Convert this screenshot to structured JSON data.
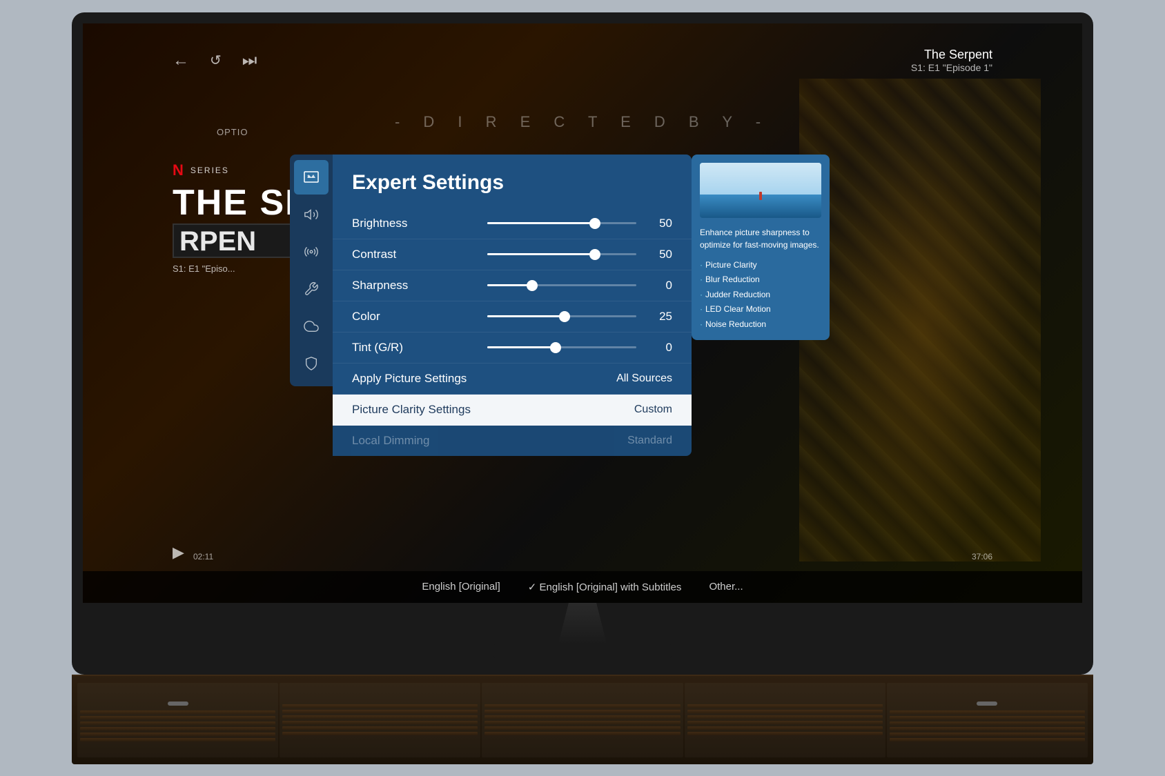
{
  "tv": {
    "show_title": "The Serpent",
    "show_episode": "S1: E1 \"Episode 1\"",
    "directed_by": "- D I R E C T E D   B Y -",
    "netflix_badge": "N",
    "netflix_series": "SERIES",
    "show_name": "THE SE",
    "show_info": "S1: E1 \"Episo",
    "options_label": "OPTIO",
    "time_left": "02:11",
    "time_right": "37:06"
  },
  "subtitles": {
    "option1": "English [Original]",
    "option2_check": "✓",
    "option2": "English [Original] with Subtitles",
    "option3": "Other..."
  },
  "sidebar": {
    "icons": [
      {
        "name": "picture-icon",
        "symbol": "🖼",
        "active": true
      },
      {
        "name": "sound-icon",
        "symbol": "🔊",
        "active": false
      },
      {
        "name": "broadcast-icon",
        "symbol": "📡",
        "active": false
      },
      {
        "name": "tools-icon",
        "symbol": "🔧",
        "active": false
      },
      {
        "name": "cloud-icon",
        "symbol": "☁",
        "active": false
      },
      {
        "name": "shield-icon",
        "symbol": "🛡",
        "active": false
      }
    ]
  },
  "settings_panel": {
    "title": "Expert Settings",
    "rows": [
      {
        "label": "Brightness",
        "value": "50",
        "type": "slider",
        "fill_pct": 72
      },
      {
        "label": "Contrast",
        "value": "50",
        "type": "slider",
        "fill_pct": 72
      },
      {
        "label": "Sharpness",
        "value": "0",
        "type": "slider",
        "fill_pct": 30
      },
      {
        "label": "Color",
        "value": "25",
        "type": "slider",
        "fill_pct": 52
      },
      {
        "label": "Tint (G/R)",
        "value": "0",
        "type": "slider",
        "fill_pct": 46
      },
      {
        "label": "Apply Picture Settings",
        "value_text": "All Sources",
        "type": "text"
      },
      {
        "label": "Picture Clarity Settings",
        "value_text": "Custom",
        "type": "text",
        "highlighted": true
      },
      {
        "label": "Local Dimming",
        "value_text": "Standard",
        "type": "text",
        "faded": true
      }
    ]
  },
  "info_panel": {
    "description": "Enhance picture sharpness to optimize for fast-moving images.",
    "features": [
      "Picture Clarity",
      "Blur Reduction",
      "Judder Reduction",
      "LED Clear Motion",
      "Noise Reduction"
    ]
  }
}
